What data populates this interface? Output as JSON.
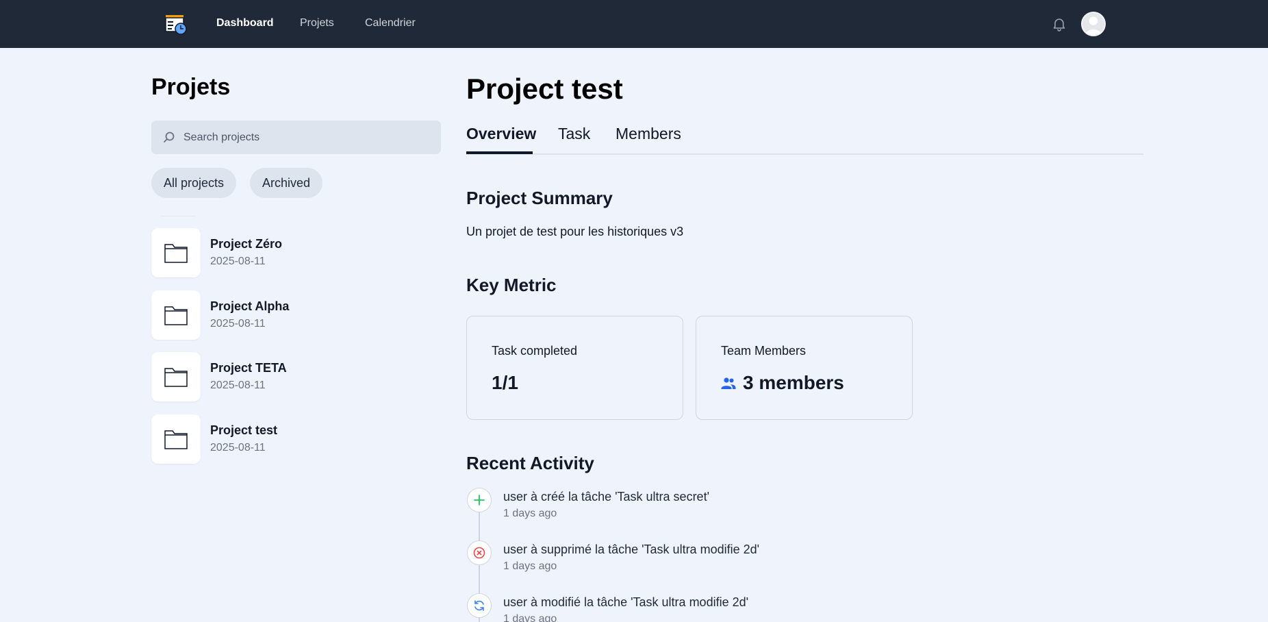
{
  "nav": {
    "links": [
      "Dashboard",
      "Projets",
      "Calendrier"
    ]
  },
  "sidebar": {
    "title": "Projets",
    "search_placeholder": "Search projects",
    "filters": [
      "All projects",
      "Archived"
    ],
    "projects": [
      {
        "name": "Project Zéro",
        "date": "2025-08-11"
      },
      {
        "name": "Project Alpha",
        "date": "2025-08-11"
      },
      {
        "name": "Project TETA",
        "date": "2025-08-11"
      },
      {
        "name": "Project test",
        "date": "2025-08-11"
      }
    ]
  },
  "main": {
    "title": "Project test",
    "tabs": [
      "Overview",
      "Task",
      "Members"
    ],
    "summary_heading": "Project Summary",
    "summary_text": "Un projet de test pour les historiques v3",
    "metrics_heading": "Key Metric",
    "metrics": [
      {
        "label": "Task completed",
        "value": "1/1"
      },
      {
        "label": "Team Members",
        "value": "3 members"
      }
    ],
    "activity_heading": "Recent Activity",
    "activity": [
      {
        "text": "user à créé la tâche 'Task ultra secret'",
        "time": "1 days ago",
        "icon": "plus-icon"
      },
      {
        "text": "user à supprimé la tâche 'Task ultra modifie 2d'",
        "time": "1 days ago",
        "icon": "x-circle-icon"
      },
      {
        "text": "user à modifié la tâche 'Task ultra modifie 2d'",
        "time": "1 days ago",
        "icon": "refresh-icon"
      }
    ]
  },
  "colors": {
    "topbar": "#1f2937",
    "background": "#eff3fc",
    "create": "#22c55e",
    "delete": "#ef4444",
    "update": "#3b82f6",
    "members_icon": "#2563eb"
  }
}
